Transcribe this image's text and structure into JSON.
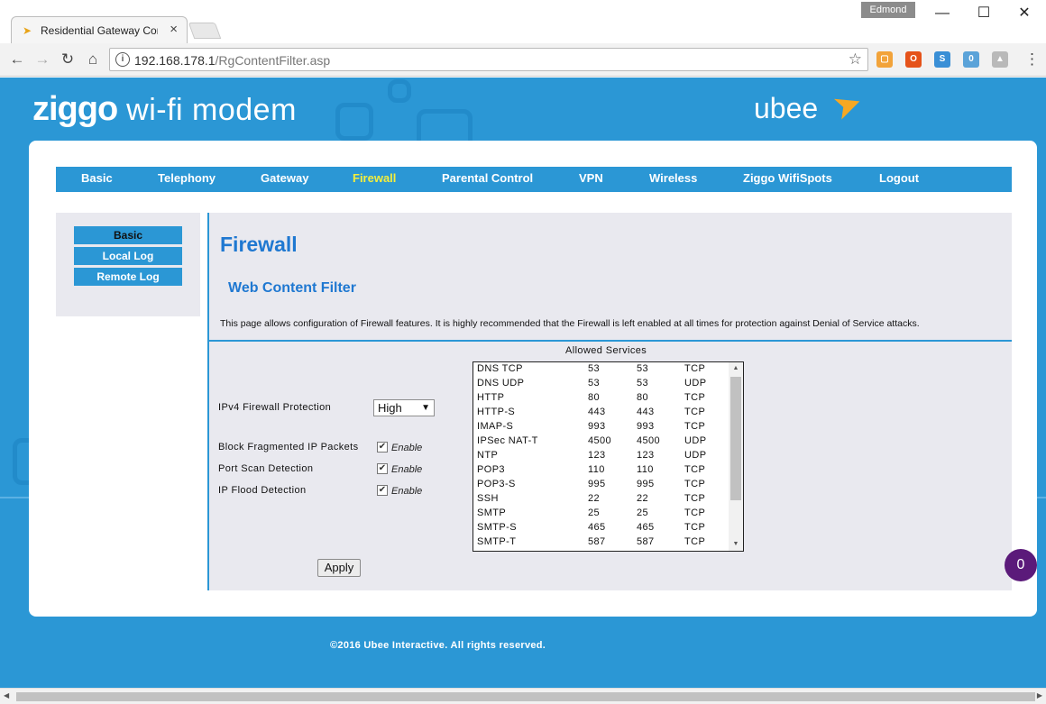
{
  "browser": {
    "tab_title": "Residential Gateway Con",
    "profile_name": "Edmond",
    "url_host": "192.168.178.1",
    "url_path": "/RgContentFilter.asp",
    "extension_badge": "0"
  },
  "header": {
    "logo_brand": "ziggo",
    "logo_tagline": "wi-fi modem",
    "vendor_logo": "ubee"
  },
  "menu": {
    "items": [
      "Basic",
      "Telephony",
      "Gateway",
      "Firewall",
      "Parental Control",
      "VPN",
      "Wireless",
      "Ziggo WifiSpots",
      "Logout"
    ],
    "active": "Firewall"
  },
  "subnav": {
    "items": [
      "Basic",
      "Local Log",
      "Remote Log"
    ],
    "active": "Basic"
  },
  "content": {
    "title": "Firewall",
    "subtitle": "Web Content Filter",
    "description": "This page allows configuration of Firewall features. It is highly recommended that the Firewall is left enabled at all times for protection against Denial of Service attacks."
  },
  "form": {
    "ipv4_label": "IPv4 Firewall Protection",
    "ipv4_value": "High",
    "checkboxes": [
      {
        "label": "Block Fragmented IP Packets",
        "option": "Enable",
        "checked": true
      },
      {
        "label": "Port Scan Detection",
        "option": "Enable",
        "checked": true
      },
      {
        "label": "IP Flood Detection",
        "option": "Enable",
        "checked": true
      }
    ],
    "apply_label": "Apply"
  },
  "services": {
    "title": "Allowed Services",
    "rows": [
      [
        "DNS TCP",
        "53",
        "53",
        "TCP"
      ],
      [
        "DNS UDP",
        "53",
        "53",
        "UDP"
      ],
      [
        "HTTP",
        "80",
        "80",
        "TCP"
      ],
      [
        "HTTP-S",
        "443",
        "443",
        "TCP"
      ],
      [
        "IMAP-S",
        "993",
        "993",
        "TCP"
      ],
      [
        "IPSec NAT-T",
        "4500",
        "4500",
        "UDP"
      ],
      [
        "NTP",
        "123",
        "123",
        "UDP"
      ],
      [
        "POP3",
        "110",
        "110",
        "TCP"
      ],
      [
        "POP3-S",
        "995",
        "995",
        "TCP"
      ],
      [
        "SSH",
        "22",
        "22",
        "TCP"
      ],
      [
        "SMTP",
        "25",
        "25",
        "TCP"
      ],
      [
        "SMTP-S",
        "465",
        "465",
        "TCP"
      ],
      [
        "SMTP-T",
        "587",
        "587",
        "TCP"
      ]
    ]
  },
  "footer": {
    "copyright": "©2016 Ubee Interactive. All rights reserved.",
    "notification_count": "0"
  },
  "colors": {
    "brand_blue": "#2b97d5",
    "active_menu": "#f4ee3c",
    "heading_blue": "#1f78d1"
  }
}
